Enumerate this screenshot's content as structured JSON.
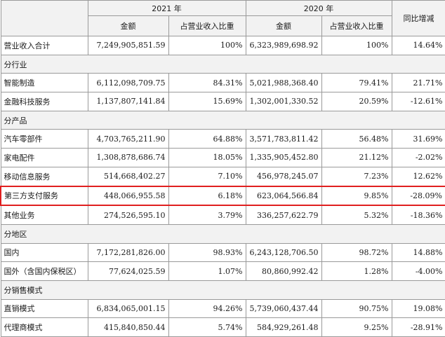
{
  "header": {
    "year_2021": "2021 年",
    "year_2020": "2020 年",
    "yoy": "同比增减",
    "amount": "金额",
    "ratio": "占营业收入比重"
  },
  "rows": [
    {
      "type": "data",
      "label": "营业收入合计",
      "a2021": "7,249,905,851.59",
      "r2021": "100%",
      "a2020": "6,323,989,698.92",
      "r2020": "100%",
      "yoy": "14.64%"
    },
    {
      "type": "section",
      "label": "分行业"
    },
    {
      "type": "data",
      "label": "智能制造",
      "a2021": "6,112,098,709.75",
      "r2021": "84.31%",
      "a2020": "5,021,988,368.40",
      "r2020": "79.41%",
      "yoy": "21.71%"
    },
    {
      "type": "data",
      "label": "金融科技服务",
      "a2021": "1,137,807,141.84",
      "r2021": "15.69%",
      "a2020": "1,302,001,330.52",
      "r2020": "20.59%",
      "yoy": "-12.61%"
    },
    {
      "type": "section",
      "label": "分产品"
    },
    {
      "type": "data",
      "label": "汽车零部件",
      "a2021": "4,703,765,211.90",
      "r2021": "64.88%",
      "a2020": "3,571,783,811.42",
      "r2020": "56.48%",
      "yoy": "31.69%"
    },
    {
      "type": "data",
      "label": "家电配件",
      "a2021": "1,308,878,686.74",
      "r2021": "18.05%",
      "a2020": "1,335,905,452.80",
      "r2020": "21.12%",
      "yoy": "-2.02%"
    },
    {
      "type": "data",
      "label": "移动信息服务",
      "a2021": "514,668,402.27",
      "r2021": "7.10%",
      "a2020": "456,978,245.07",
      "r2020": "7.23%",
      "yoy": "12.62%"
    },
    {
      "type": "highlight",
      "label": "第三方支付服务",
      "a2021": "448,066,955.58",
      "r2021": "6.18%",
      "a2020": "623,064,566.84",
      "r2020": "9.85%",
      "yoy": "-28.09%"
    },
    {
      "type": "data",
      "label": "其他业务",
      "a2021": "274,526,595.10",
      "r2021": "3.79%",
      "a2020": "336,257,622.79",
      "r2020": "5.32%",
      "yoy": "-18.36%"
    },
    {
      "type": "section",
      "label": "分地区"
    },
    {
      "type": "data",
      "label": "国内",
      "a2021": "7,172,281,826.00",
      "r2021": "98.93%",
      "a2020": "6,243,128,706.50",
      "r2020": "98.72%",
      "yoy": "14.88%"
    },
    {
      "type": "data",
      "label": "国外（含国内保税区）",
      "a2021": "77,624,025.59",
      "r2021": "1.07%",
      "a2020": "80,860,992.42",
      "r2020": "1.28%",
      "yoy": "-4.00%"
    },
    {
      "type": "section",
      "label": "分销售模式"
    },
    {
      "type": "data",
      "label": "直销模式",
      "a2021": "6,834,065,001.15",
      "r2021": "94.26%",
      "a2020": "5,739,060,437.44",
      "r2020": "90.75%",
      "yoy": "19.08%"
    },
    {
      "type": "data",
      "label": "代理商模式",
      "a2021": "415,840,850.44",
      "r2021": "5.74%",
      "a2020": "584,929,261.48",
      "r2020": "9.25%",
      "yoy": "-28.91%"
    }
  ],
  "highlight_color": "#e01f1f"
}
